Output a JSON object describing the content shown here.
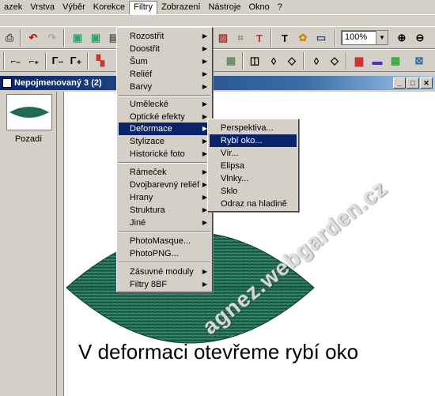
{
  "menubar": [
    "azek",
    "Vrstva",
    "Výběr",
    "Korekce",
    "Filtry",
    "Zobrazení",
    "Nástroje",
    "Okno",
    "?"
  ],
  "toolbar": {
    "zoom_value": "100%"
  },
  "document": {
    "title": "Nepojmenovaný 3 (2)",
    "layer_name": "Pozadí",
    "caption": "V deformaci otevřeme rybí oko",
    "watermark": "agnez.webgarden.cz",
    "leaf_color": "#1f6b55"
  },
  "filtry_menu": {
    "groups": [
      [
        "Rozostřit",
        "Doostřit",
        "Šum",
        "Reliéf",
        "Barvy"
      ],
      [
        "Umělecké",
        "Optické efekty",
        "Deformace",
        "Stylizace",
        "Historické foto"
      ],
      [
        "Rámeček",
        "Dvojbarevný reliéf",
        "Hrany",
        "Struktura",
        "Jiné"
      ],
      [
        "PhotoMasque...",
        "PhotoPNG..."
      ],
      [
        "Zásuvné moduly",
        "Filtry 8BF"
      ]
    ],
    "highlighted": "Deformace"
  },
  "deformace_submenu": {
    "items": [
      "Perspektiva...",
      "Rybí oko...",
      "Vír...",
      "Elipsa",
      "Vlnky...",
      "Sklo",
      "Odraz na hladině"
    ],
    "highlighted": "Rybí oko..."
  }
}
